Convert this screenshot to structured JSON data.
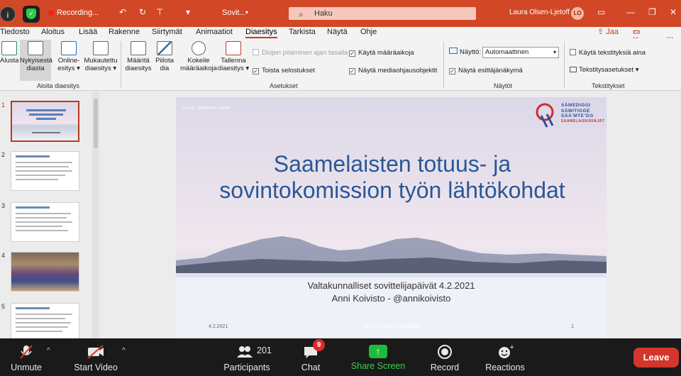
{
  "zoom": {
    "recording_label": "Recording...",
    "bottom": {
      "unmute": "Unmute",
      "start_video": "Start Video",
      "participants": "Participants",
      "participants_count": "201",
      "chat": "Chat",
      "chat_badge": "9",
      "share_screen": "Share Screen",
      "record": "Record",
      "reactions": "Reactions",
      "leave": "Leave"
    }
  },
  "titlebar": {
    "file_title": "Sovit...",
    "search_placeholder": "Haku",
    "user_name": "Laura Olsen-Ljetoff",
    "user_initials": "LO"
  },
  "menu": {
    "tabs": [
      "Tiedosto",
      "Aloitus",
      "Lisää",
      "Rakenne",
      "Siirtymät",
      "Animaatiot",
      "Diaesitys",
      "Tarkista",
      "Näytä",
      "Ohje"
    ],
    "active_tab": "Diaesitys",
    "share": "Jaa",
    "comments": "Kommentit"
  },
  "ribbon": {
    "group_start": {
      "label": "Aloita diaesitys",
      "from_start": "Alusta",
      "current_slide_l1": "Nykyisestä",
      "current_slide_l2": "diasta",
      "online_l1": "Online-",
      "online_l2": "esitys",
      "custom_l1": "Mukautettu",
      "custom_l2": "diaesitys"
    },
    "group_setup": {
      "label": "Asetukset",
      "setup_l1": "Määritä",
      "setup_l2": "diaesitys",
      "hide_l1": "Piilota",
      "hide_l2": "dia",
      "rehearse_l1": "Kokeile",
      "rehearse_l2": "määräaikoja",
      "record_l1": "Tallenna",
      "record_l2": "diaesitys",
      "keep_slides": "Diojen pitäminen ajan tasalla",
      "play_narrations": "Toista selostukset",
      "use_timings": "Käytä määräaikoja",
      "show_media": "Näytä mediaohjausobjektit"
    },
    "group_monitors": {
      "label": "Näytöt",
      "monitor_label": "Näyttö:",
      "monitor_value": "Automaattinen",
      "presenter_view": "Näytä esittäjänäkymä"
    },
    "group_captions": {
      "label": "Tekstitykset",
      "use_subtitles": "Käytä tekstityksiä aina",
      "subtitle_settings": "Tekstitysasetukset"
    }
  },
  "thumbnails": {
    "numbers": [
      "1",
      "2",
      "3",
      "4",
      "5"
    ]
  },
  "slide": {
    "photo_credit": "Kuva: Johanna Laiho",
    "title": "Saamelaisten totuus- ja sovintokomission työn lähtökohdat",
    "subtitle_line1": "Valtakunnalliset sovittelijapäivät 4.2.2021",
    "subtitle_line2": "Anni Koivisto - @annikoivisto",
    "footer_date": "4.2.2021",
    "footer_center": "Anni Koivisto | Sámediggi",
    "footer_number": "1",
    "logo_text": [
      "SÁMEDIGGI",
      "SÄMITIGGE",
      "SÄÄ'MTE'ĞG",
      "SAAMELAISKÄRÄJÄT"
    ]
  },
  "colors": {
    "office_accent": "#d24726",
    "title_blue": "#2b5797",
    "zoom_green": "#3ccf4e",
    "leave_red": "#d2362c"
  }
}
